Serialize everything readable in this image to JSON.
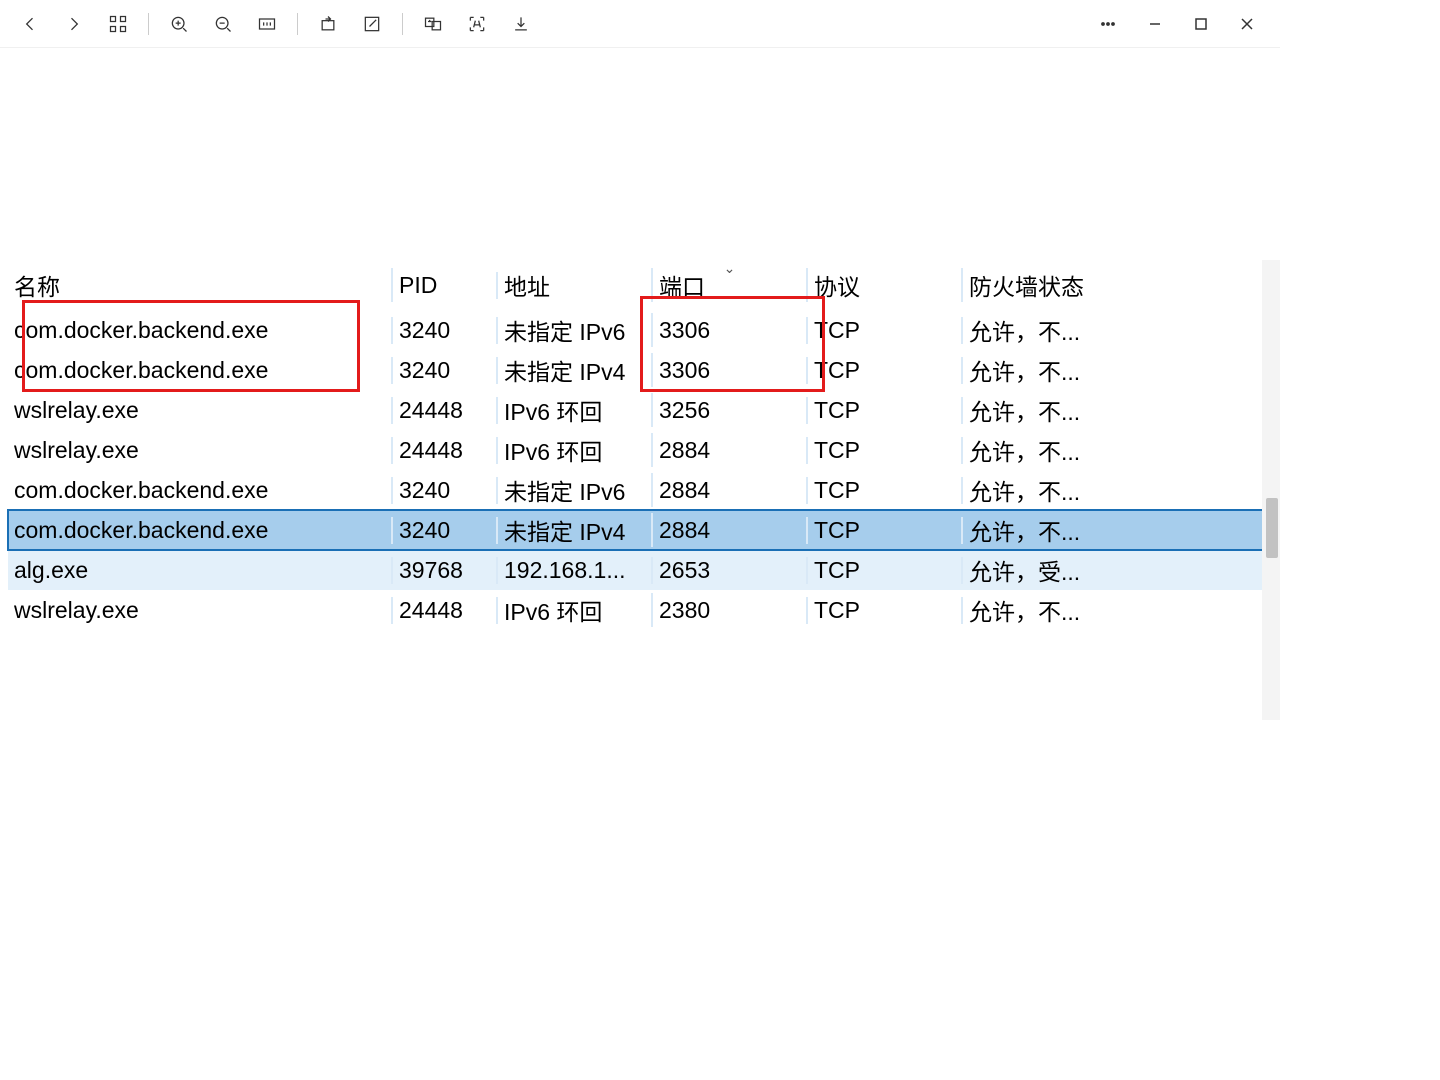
{
  "toolbar": {
    "back": "Back",
    "forward": "Forward",
    "apps": "Apps",
    "zoom_in": "Zoom In",
    "zoom_out": "Zoom Out",
    "actual": "1:1",
    "rotate": "Rotate",
    "edit": "Edit",
    "translate": "Translate",
    "ocr": "OCR",
    "save": "Save",
    "more": "More",
    "minimize": "Minimize",
    "maximize": "Maximize",
    "close": "Close"
  },
  "table": {
    "headers": {
      "name": "名称",
      "pid": "PID",
      "address": "地址",
      "port": "端口",
      "protocol": "协议",
      "firewall": "防火墙状态"
    },
    "sort_column": "port",
    "sort_dir": "desc",
    "rows": [
      {
        "name": "com.docker.backend.exe",
        "pid": "3240",
        "address": "未指定 IPv6",
        "port": "3306",
        "protocol": "TCP",
        "firewall": "允许，不...",
        "state": ""
      },
      {
        "name": "com.docker.backend.exe",
        "pid": "3240",
        "address": "未指定 IPv4",
        "port": "3306",
        "protocol": "TCP",
        "firewall": "允许，不...",
        "state": ""
      },
      {
        "name": "wslrelay.exe",
        "pid": "24448",
        "address": "IPv6 环回",
        "port": "3256",
        "protocol": "TCP",
        "firewall": "允许，不...",
        "state": ""
      },
      {
        "name": "wslrelay.exe",
        "pid": "24448",
        "address": "IPv6 环回",
        "port": "2884",
        "protocol": "TCP",
        "firewall": "允许，不...",
        "state": ""
      },
      {
        "name": "com.docker.backend.exe",
        "pid": "3240",
        "address": "未指定 IPv6",
        "port": "2884",
        "protocol": "TCP",
        "firewall": "允许，不...",
        "state": ""
      },
      {
        "name": "com.docker.backend.exe",
        "pid": "3240",
        "address": "未指定 IPv4",
        "port": "2884",
        "protocol": "TCP",
        "firewall": "允许，不...",
        "state": "selected"
      },
      {
        "name": "alg.exe",
        "pid": "39768",
        "address": "192.168.1...",
        "port": "2653",
        "protocol": "TCP",
        "firewall": "允许，受...",
        "state": "highlight"
      },
      {
        "name": "wslrelay.exe",
        "pid": "24448",
        "address": "IPv6 环回",
        "port": "2380",
        "protocol": "TCP",
        "firewall": "允许，不...",
        "state": ""
      }
    ]
  }
}
